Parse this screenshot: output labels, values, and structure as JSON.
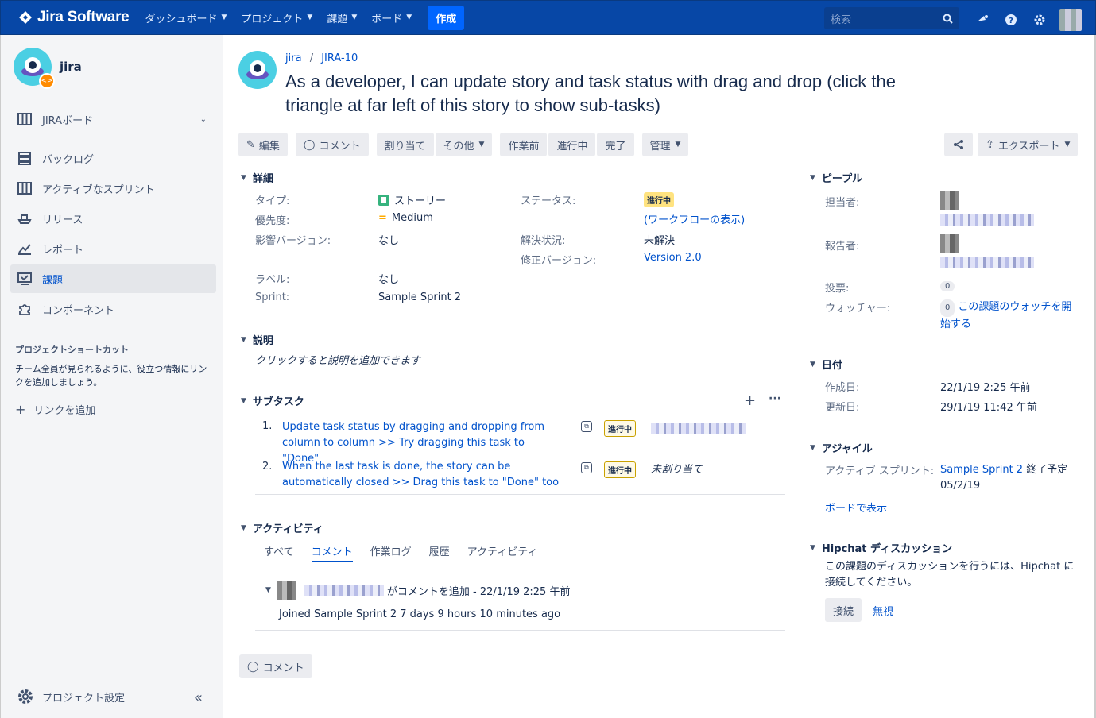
{
  "nav": {
    "logo": "Jira Software",
    "items": [
      "ダッシュボード",
      "プロジェクト",
      "課題",
      "ボード"
    ],
    "create": "作成",
    "search_placeholder": "検索"
  },
  "sidebar": {
    "project_name": "jira",
    "board": "JIRAボード",
    "items": [
      "バックログ",
      "アクティブなスプリント",
      "リリース",
      "レポート",
      "課題",
      "コンポーネント"
    ],
    "shortcut_heading": "プロジェクトショートカット",
    "shortcut_text": "チーム全員が見られるように、役立つ情報にリンクを追加しましょう。",
    "add_link": "リンクを追加",
    "settings": "プロジェクト設定"
  },
  "issue": {
    "project": "jira",
    "key": "JIRA-10",
    "title": "As a developer, I can update story and task status with drag and drop (click the triangle at far left of this story to show sub-tasks)"
  },
  "toolbar": {
    "edit": "編集",
    "comment": "コメント",
    "assign": "割り当て",
    "more": "その他",
    "todo": "作業前",
    "in_progress": "進行中",
    "done": "完了",
    "admin": "管理",
    "export": "エクスポート"
  },
  "details": {
    "heading": "詳細",
    "type_label": "タイプ:",
    "type_value": "ストーリー",
    "priority_label": "優先度:",
    "priority_value": "Medium",
    "affects_label": "影響バージョン:",
    "affects_value": "なし",
    "labels_label": "ラベル:",
    "labels_value": "なし",
    "sprint_label": "Sprint:",
    "sprint_value": "Sample Sprint 2",
    "status_label": "ステータス:",
    "status_value": "進行中",
    "workflow_link": "(ワークフローの表示)",
    "resolution_label": "解決状況:",
    "resolution_value": "未解決",
    "fix_label": "修正バージョン:",
    "fix_value": "Version 2.0"
  },
  "description": {
    "heading": "説明",
    "placeholder": "クリックすると説明を追加できます"
  },
  "subtasks": {
    "heading": "サブタスク",
    "items": [
      {
        "num": "1.",
        "text": "Update task status by dragging and dropping from column to column >> Try dragging this task to \"Done\"",
        "status": "進行中"
      },
      {
        "num": "2.",
        "text": "When the last task is done, the story can be automatically closed >> Drag this task to \"Done\" too",
        "status": "進行中",
        "assignee": "未割り当て"
      }
    ]
  },
  "activity": {
    "heading": "アクティビティ",
    "tabs": [
      "すべて",
      "コメント",
      "作業ログ",
      "履歴",
      "アクティビティ"
    ],
    "comment_action": "がコメントを追加 - 22/1/19 2:25 午前",
    "comment_body": "Joined Sample Sprint 2 7 days 9 hours 10 minutes ago",
    "comment_button": "コメント"
  },
  "people": {
    "heading": "ピープル",
    "assignee_label": "担当者:",
    "reporter_label": "報告者:",
    "votes_label": "投票:",
    "votes_count": "0",
    "watchers_label": "ウォッチャー:",
    "watchers_count": "0",
    "watch_link": "この課題のウォッチを開始する"
  },
  "dates": {
    "heading": "日付",
    "created_label": "作成日:",
    "created_value": "22/1/19 2:25 午前",
    "updated_label": "更新日:",
    "updated_value": "29/1/19 11:42 午前"
  },
  "agile": {
    "heading": "アジャイル",
    "sprint_label": "アクティブ スプリント:",
    "sprint_link": "Sample Sprint 2",
    "sprint_end": "終了予定",
    "sprint_date": "05/2/19",
    "board_link": "ボードで表示"
  },
  "hipchat": {
    "heading": "Hipchat ディスカッション",
    "text": "この課題のディスカッションを行うには、Hipchat に接続してください。",
    "connect": "接続",
    "ignore": "無視"
  }
}
